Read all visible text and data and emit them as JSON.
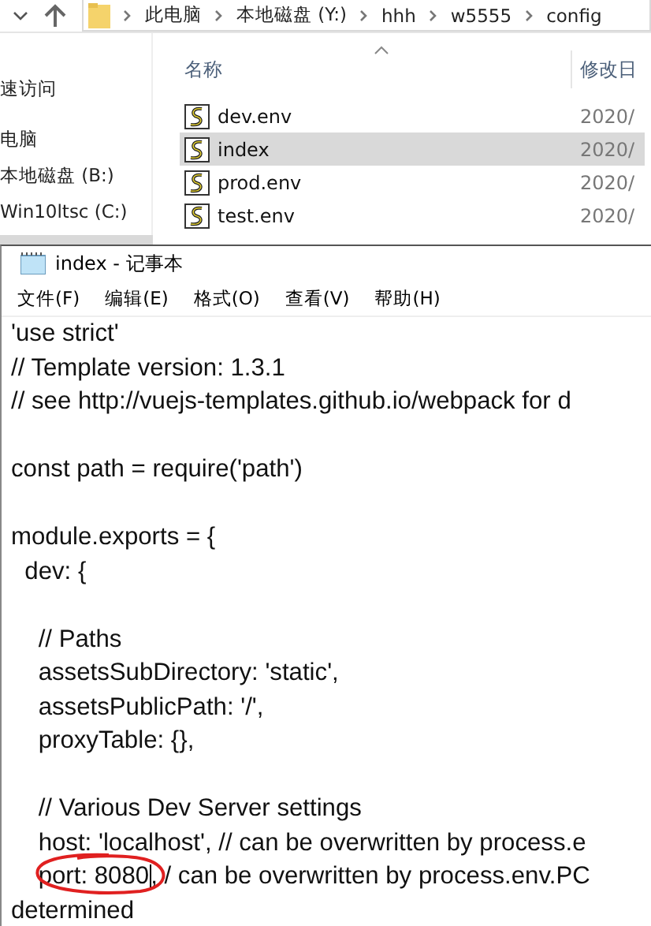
{
  "explorer": {
    "breadcrumbs": [
      "此电脑",
      "本地磁盘 (Y:)",
      "hhh",
      "w5555",
      "config"
    ],
    "nav_items": [
      {
        "label": "速访问",
        "selected": false
      },
      {
        "label": "电脑",
        "selected": false
      },
      {
        "label": "本地磁盘 (B:)",
        "selected": false
      },
      {
        "label": "Win10ltsc (C:)",
        "selected": false
      }
    ],
    "columns": [
      "名称",
      "修改日"
    ],
    "files": [
      {
        "name": "dev.env",
        "date": "2020/",
        "selected": false
      },
      {
        "name": "index",
        "date": "2020/",
        "selected": true
      },
      {
        "name": "prod.env",
        "date": "2020/",
        "selected": false
      },
      {
        "name": "test.env",
        "date": "2020/",
        "selected": false
      }
    ]
  },
  "notepad": {
    "title": "index - 记事本",
    "menu": [
      "文件(F)",
      "编辑(E)",
      "格式(O)",
      "查看(V)",
      "帮助(H)"
    ],
    "code_blocks": [
      [
        "'use strict'",
        "// Template version: 1.3.1",
        "// see http://vuejs-templates.github.io/webpack for d"
      ],
      [
        "const path = require('path')"
      ],
      [
        "module.exports = {",
        "  dev: {"
      ],
      [
        "    // Paths",
        "    assetsSubDirectory: 'static',",
        "    assetsPublicPath: '/',",
        "    proxyTable: {},"
      ],
      [
        "    // Various Dev Server settings",
        "    host: 'localhost', // can be overwritten by process.e",
        {
          "before_caret": "    port: 8080",
          "after_caret": ", / can be overwritten by process.env.PC",
          "circled": true
        },
        "determined"
      ]
    ]
  }
}
